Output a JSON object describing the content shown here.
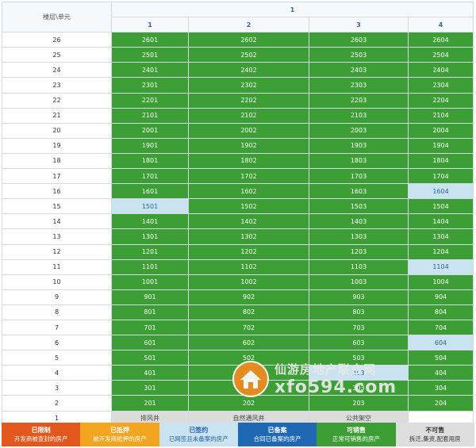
{
  "header": {
    "corner_label": "楼层\\单元",
    "building": "1",
    "units": [
      "1",
      "2",
      "3",
      "4"
    ]
  },
  "rows": [
    {
      "floor": "26",
      "cells": [
        {
          "t": "2601",
          "s": "kexiao"
        },
        {
          "t": "2602",
          "s": "kexiao"
        },
        {
          "t": "2603",
          "s": "kexiao"
        },
        {
          "t": "2604",
          "s": "kexiao"
        }
      ]
    },
    {
      "floor": "25",
      "cells": [
        {
          "t": "2501",
          "s": "kexiao"
        },
        {
          "t": "2502",
          "s": "kexiao"
        },
        {
          "t": "2503",
          "s": "kexiao"
        },
        {
          "t": "2504",
          "s": "kexiao"
        }
      ]
    },
    {
      "floor": "24",
      "cells": [
        {
          "t": "2401",
          "s": "kexiao"
        },
        {
          "t": "2402",
          "s": "kexiao"
        },
        {
          "t": "2403",
          "s": "kexiao"
        },
        {
          "t": "2404",
          "s": "kexiao"
        }
      ]
    },
    {
      "floor": "23",
      "cells": [
        {
          "t": "2301",
          "s": "kexiao"
        },
        {
          "t": "2302",
          "s": "kexiao"
        },
        {
          "t": "2303",
          "s": "kexiao"
        },
        {
          "t": "2304",
          "s": "kexiao"
        }
      ]
    },
    {
      "floor": "22",
      "cells": [
        {
          "t": "2201",
          "s": "kexiao"
        },
        {
          "t": "2202",
          "s": "kexiao"
        },
        {
          "t": "2203",
          "s": "kexiao"
        },
        {
          "t": "2204",
          "s": "kexiao"
        }
      ]
    },
    {
      "floor": "21",
      "cells": [
        {
          "t": "2101",
          "s": "kexiao"
        },
        {
          "t": "2102",
          "s": "kexiao"
        },
        {
          "t": "2103",
          "s": "kexiao"
        },
        {
          "t": "2104",
          "s": "kexiao"
        }
      ]
    },
    {
      "floor": "20",
      "cells": [
        {
          "t": "2001",
          "s": "kexiao"
        },
        {
          "t": "2002",
          "s": "kexiao"
        },
        {
          "t": "2003",
          "s": "kexiao"
        },
        {
          "t": "2004",
          "s": "kexiao"
        }
      ]
    },
    {
      "floor": "19",
      "cells": [
        {
          "t": "1901",
          "s": "kexiao"
        },
        {
          "t": "1902",
          "s": "kexiao"
        },
        {
          "t": "1903",
          "s": "kexiao"
        },
        {
          "t": "1904",
          "s": "kexiao"
        }
      ]
    },
    {
      "floor": "18",
      "cells": [
        {
          "t": "1801",
          "s": "kexiao"
        },
        {
          "t": "1802",
          "s": "kexiao"
        },
        {
          "t": "1803",
          "s": "kexiao"
        },
        {
          "t": "1804",
          "s": "kexiao"
        }
      ]
    },
    {
      "floor": "17",
      "cells": [
        {
          "t": "1701",
          "s": "kexiao"
        },
        {
          "t": "1702",
          "s": "kexiao"
        },
        {
          "t": "1703",
          "s": "kexiao"
        },
        {
          "t": "1704",
          "s": "kexiao"
        }
      ]
    },
    {
      "floor": "16",
      "cells": [
        {
          "t": "1601",
          "s": "kexiao"
        },
        {
          "t": "1602",
          "s": "kexiao"
        },
        {
          "t": "1603",
          "s": "kexiao"
        },
        {
          "t": "1604",
          "s": "qianyue"
        }
      ]
    },
    {
      "floor": "15",
      "cells": [
        {
          "t": "1501",
          "s": "qianyue"
        },
        {
          "t": "1502",
          "s": "kexiao"
        },
        {
          "t": "1503",
          "s": "kexiao"
        },
        {
          "t": "1504",
          "s": "kexiao"
        }
      ]
    },
    {
      "floor": "14",
      "cells": [
        {
          "t": "1401",
          "s": "kexiao"
        },
        {
          "t": "1402",
          "s": "kexiao"
        },
        {
          "t": "1403",
          "s": "kexiao"
        },
        {
          "t": "1404",
          "s": "kexiao"
        }
      ]
    },
    {
      "floor": "13",
      "cells": [
        {
          "t": "1301",
          "s": "kexiao"
        },
        {
          "t": "1302",
          "s": "kexiao"
        },
        {
          "t": "1303",
          "s": "kexiao"
        },
        {
          "t": "1304",
          "s": "kexiao"
        }
      ]
    },
    {
      "floor": "12",
      "cells": [
        {
          "t": "1201",
          "s": "kexiao"
        },
        {
          "t": "1202",
          "s": "kexiao"
        },
        {
          "t": "1203",
          "s": "kexiao"
        },
        {
          "t": "1204",
          "s": "kexiao"
        }
      ]
    },
    {
      "floor": "11",
      "cells": [
        {
          "t": "1101",
          "s": "kexiao"
        },
        {
          "t": "1102",
          "s": "kexiao"
        },
        {
          "t": "1103",
          "s": "kexiao"
        },
        {
          "t": "1104",
          "s": "qianyue"
        }
      ]
    },
    {
      "floor": "10",
      "cells": [
        {
          "t": "1001",
          "s": "kexiao"
        },
        {
          "t": "1002",
          "s": "kexiao"
        },
        {
          "t": "1003",
          "s": "kexiao"
        },
        {
          "t": "1004",
          "s": "kexiao"
        }
      ]
    },
    {
      "floor": "9",
      "cells": [
        {
          "t": "901",
          "s": "kexiao"
        },
        {
          "t": "902",
          "s": "kexiao"
        },
        {
          "t": "903",
          "s": "kexiao"
        },
        {
          "t": "904",
          "s": "kexiao"
        }
      ]
    },
    {
      "floor": "8",
      "cells": [
        {
          "t": "801",
          "s": "kexiao"
        },
        {
          "t": "802",
          "s": "kexiao"
        },
        {
          "t": "803",
          "s": "kexiao"
        },
        {
          "t": "804",
          "s": "kexiao"
        }
      ]
    },
    {
      "floor": "7",
      "cells": [
        {
          "t": "701",
          "s": "kexiao"
        },
        {
          "t": "702",
          "s": "kexiao"
        },
        {
          "t": "703",
          "s": "kexiao"
        },
        {
          "t": "704",
          "s": "kexiao"
        }
      ]
    },
    {
      "floor": "6",
      "cells": [
        {
          "t": "601",
          "s": "kexiao"
        },
        {
          "t": "602",
          "s": "kexiao"
        },
        {
          "t": "603",
          "s": "kexiao"
        },
        {
          "t": "604",
          "s": "qianyue"
        }
      ]
    },
    {
      "floor": "5",
      "cells": [
        {
          "t": "501",
          "s": "kexiao"
        },
        {
          "t": "502",
          "s": "kexiao"
        },
        {
          "t": "503",
          "s": "kexiao"
        },
        {
          "t": "504",
          "s": "kexiao"
        }
      ]
    },
    {
      "floor": "4",
      "cells": [
        {
          "t": "401",
          "s": "kexiao"
        },
        {
          "t": "402",
          "s": "kexiao"
        },
        {
          "t": "403",
          "s": "qianyue"
        },
        {
          "t": "404",
          "s": "kexiao"
        }
      ]
    },
    {
      "floor": "3",
      "cells": [
        {
          "t": "301",
          "s": "kexiao"
        },
        {
          "t": "302",
          "s": "kexiao"
        },
        {
          "t": "303",
          "s": "kexiao"
        },
        {
          "t": "304",
          "s": "kexiao"
        }
      ]
    },
    {
      "floor": "2",
      "cells": [
        {
          "t": "201",
          "s": "kexiao"
        },
        {
          "t": "202",
          "s": "kexiao"
        },
        {
          "t": "203",
          "s": "kexiao"
        },
        {
          "t": "204",
          "s": "kexiao"
        }
      ]
    },
    {
      "floor": "1",
      "cells": [
        {
          "t": "排风井",
          "s": "buke"
        },
        {
          "t": "自然通风井",
          "s": "buke"
        },
        {
          "t": "公共架空",
          "s": "buke"
        },
        {
          "t": "",
          "s": "empty"
        }
      ]
    }
  ],
  "legend": [
    {
      "title": "已限制",
      "desc": "开发商被查封的房产"
    },
    {
      "title": "已抵押",
      "desc": "被开发商抵押的房产"
    },
    {
      "title": "已签约",
      "desc": "已网签且未备案的房产"
    },
    {
      "title": "已备案",
      "desc": "合同已备案的房产"
    },
    {
      "title": "可销售",
      "desc": "正常可销售的房产"
    },
    {
      "title": "不可售",
      "desc": "拆迁,集资,配套用房"
    }
  ],
  "watermark": {
    "line1": "仙游房地产联合网",
    "line2": "xfo594.com"
  }
}
